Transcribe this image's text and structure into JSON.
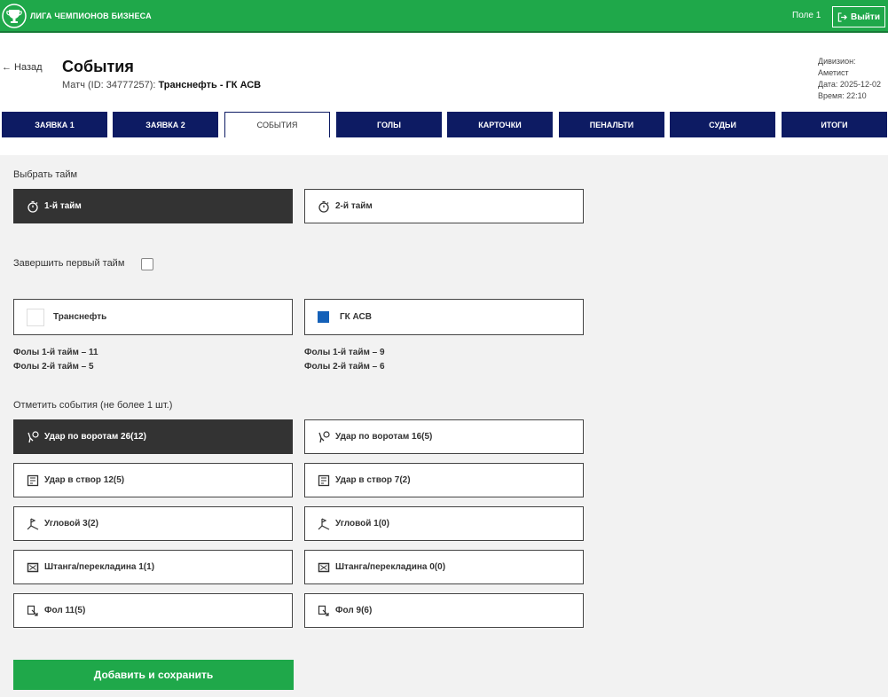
{
  "topbar": {
    "brand": "ЛИГА ЧЕМПИОНОВ БИЗНЕСА",
    "field": "Поле 1",
    "logout_label": "Выйти",
    "accent": "#1fa84a"
  },
  "header": {
    "back_label": "← Назад",
    "title": "События",
    "match_prefix": "Матч (ID: 34777257):",
    "match_teams": "Транснефть - ГК АСВ",
    "division": "Дивизион: Аметист",
    "date": "Дата: 2025-12-02",
    "time": "Время: 22:10"
  },
  "tabs": [
    {
      "label": "ЗАЯВКА 1",
      "active": false
    },
    {
      "label": "ЗАЯВКА 2",
      "active": false
    },
    {
      "label": "СОБЫТИЯ",
      "active": true
    },
    {
      "label": "ГОЛЫ",
      "active": false
    },
    {
      "label": "КАРТОЧКИ",
      "active": false
    },
    {
      "label": "ПЕНАЛЬТИ",
      "active": false
    },
    {
      "label": "СУДЬИ",
      "active": false
    },
    {
      "label": "ИТОГИ",
      "active": false
    }
  ],
  "half_select": {
    "label": "Выбрать тайм",
    "first": "1-й тайм",
    "second": "2-й тайм",
    "selected": "1-й тайм"
  },
  "finish_half": {
    "label": "Завершить первый тайм",
    "checked": false
  },
  "teams": {
    "left": {
      "name": "Транснефть",
      "color": "#ffffff",
      "fouls_1": "Фолы 1-й тайм – 11",
      "fouls_2": "Фолы 2-й тайм – 5"
    },
    "right": {
      "name": "ГК АСВ",
      "color": "#1460b8",
      "fouls_1": "Фолы 1-й тайм – 9",
      "fouls_2": "Фолы 2-й тайм – 6"
    }
  },
  "events": {
    "label": "Отметить события (не более 1 шт.)",
    "left": [
      {
        "label": "Удар по воротам 26(12)",
        "icon": "shot-icon",
        "selected": true
      },
      {
        "label": "Удар в створ 12(5)",
        "icon": "on-target-icon",
        "selected": false
      },
      {
        "label": "Угловой 3(2)",
        "icon": "corner-icon",
        "selected": false
      },
      {
        "label": "Штанга/перекладина 1(1)",
        "icon": "post-icon",
        "selected": false
      },
      {
        "label": "Фол 11(5)",
        "icon": "foul-icon",
        "selected": false
      }
    ],
    "right": [
      {
        "label": "Удар по воротам 16(5)",
        "icon": "shot-icon",
        "selected": false
      },
      {
        "label": "Удар в створ 7(2)",
        "icon": "on-target-icon",
        "selected": false
      },
      {
        "label": "Угловой 1(0)",
        "icon": "corner-icon",
        "selected": false
      },
      {
        "label": "Штанга/перекладина 0(0)",
        "icon": "post-icon",
        "selected": false
      },
      {
        "label": "Фол 9(6)",
        "icon": "foul-icon",
        "selected": false
      }
    ]
  },
  "save_label": "Добавить и сохранить"
}
